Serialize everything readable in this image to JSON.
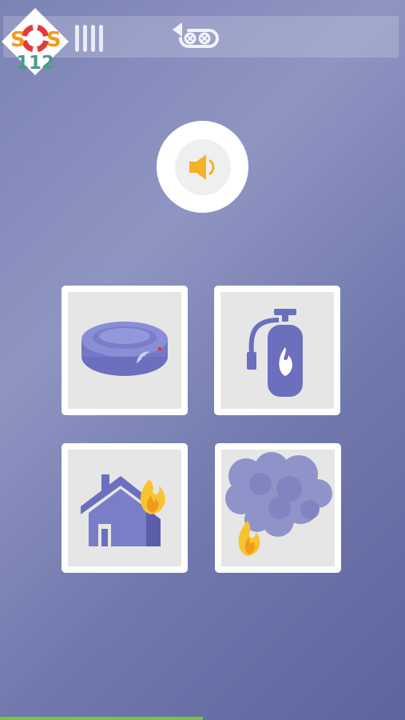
{
  "logo": {
    "sos_text": "SOS",
    "number_text": "112"
  },
  "lives": {
    "count": 4
  },
  "undo": {
    "icon": "undo-icon"
  },
  "sound": {
    "icon": "speaker-icon"
  },
  "answers": [
    {
      "id": "smoke-detector",
      "icon": "smoke-detector-icon"
    },
    {
      "id": "fire-extinguisher",
      "icon": "fire-extinguisher-icon"
    },
    {
      "id": "house-fire",
      "icon": "house-fire-icon"
    },
    {
      "id": "smoke-fire",
      "icon": "smoke-fire-icon"
    }
  ],
  "progress": {
    "fraction": 0.5
  },
  "colors": {
    "accent_purple": "#6b6fbe",
    "flame_yellow": "#f7c431",
    "flame_orange": "#f39a1e",
    "speaker_orange": "#f5b12a",
    "progress_green": "#7cc242",
    "logo_red": "#e5383b",
    "logo_teal": "#4a9a8c"
  }
}
